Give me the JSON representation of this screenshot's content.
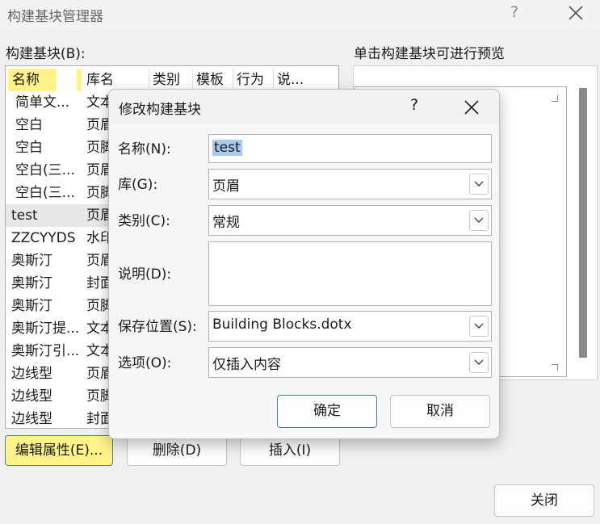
{
  "main_dialog": {
    "title": "构建基块管理器",
    "help": "?",
    "blocks_label": "构建基块(B):",
    "preview_label": "单击构建基块可进行预览",
    "columns": [
      "名称",
      "库名",
      "类别",
      "模板",
      "行为",
      "说..."
    ],
    "rows": [
      {
        "name": "简单文...",
        "lib": "文本"
      },
      {
        "name": "空白",
        "lib": "页眉"
      },
      {
        "name": "空白",
        "lib": "页脚"
      },
      {
        "name": "空白(三...",
        "lib": "页眉"
      },
      {
        "name": "空白(三...",
        "lib": "页脚"
      },
      {
        "name": "test",
        "lib": "页眉"
      },
      {
        "name": "ZZCYYDS",
        "lib": "水印"
      },
      {
        "name": "奥斯汀",
        "lib": "页眉"
      },
      {
        "name": "奥斯汀",
        "lib": "封面"
      },
      {
        "name": "奥斯汀",
        "lib": "页脚"
      },
      {
        "name": "奥斯汀提...",
        "lib": "文本"
      },
      {
        "name": "奥斯汀引...",
        "lib": "文本"
      },
      {
        "name": "边线型",
        "lib": "页眉"
      },
      {
        "name": "边线型",
        "lib": "页脚"
      },
      {
        "name": "边线型",
        "lib": "封面"
      }
    ],
    "buttons": {
      "edit_props": "编辑属性(E)...",
      "delete": "删除(D)",
      "insert": "插入(I)",
      "close": "关闭"
    }
  },
  "modify_dialog": {
    "title": "修改构建基块",
    "help": "?",
    "fields": {
      "name": {
        "label": "名称(N):",
        "value": "test"
      },
      "gallery": {
        "label": "库(G):",
        "value": "页眉"
      },
      "category": {
        "label": "类别(C):",
        "value": "常规"
      },
      "description": {
        "label": "说明(D):",
        "value": ""
      },
      "save_in": {
        "label": "保存位置(S):",
        "value": "Building Blocks.dotx"
      },
      "options": {
        "label": "选项(O):",
        "value": "仅插入内容"
      }
    },
    "buttons": {
      "ok": "确定",
      "cancel": "取消"
    }
  },
  "colors": {
    "highlight": "#fff38a",
    "selection": "#a6cbef",
    "accent_border": "#4f7c9b"
  },
  "icons": [
    "close-icon",
    "chevron-down-icon",
    "help-icon"
  ]
}
